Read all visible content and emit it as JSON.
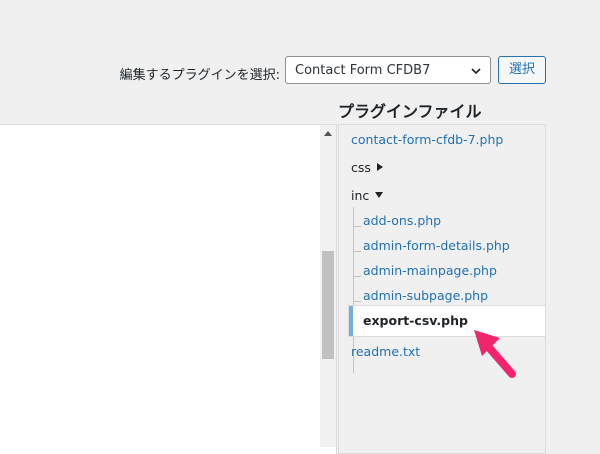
{
  "plugin_select": {
    "label": "編集するプラグインを選択:",
    "selected": "Contact Form CFDB7",
    "button": "選択"
  },
  "files": {
    "heading": "プラグインファイル",
    "items": [
      {
        "name": "contact-form-cfdb-7.php"
      },
      {
        "name": "css"
      },
      {
        "name": "inc"
      },
      {
        "name": "add-ons.php"
      },
      {
        "name": "admin-form-details.php"
      },
      {
        "name": "admin-mainpage.php"
      },
      {
        "name": "admin-subpage.php"
      },
      {
        "name": "export-csv.php"
      },
      {
        "name": "readme.txt"
      }
    ],
    "active": "export-csv.php"
  },
  "colors": {
    "accent": "#2271b1",
    "highlight_bar": "#72aee6",
    "annotation_arrow": "#f0256d"
  },
  "icons": {
    "select_chevron": "chevron-down-icon",
    "folder_collapsed": "triangle-right-icon",
    "folder_expanded": "triangle-down-icon",
    "annotation": "arrow-pointer-icon"
  }
}
